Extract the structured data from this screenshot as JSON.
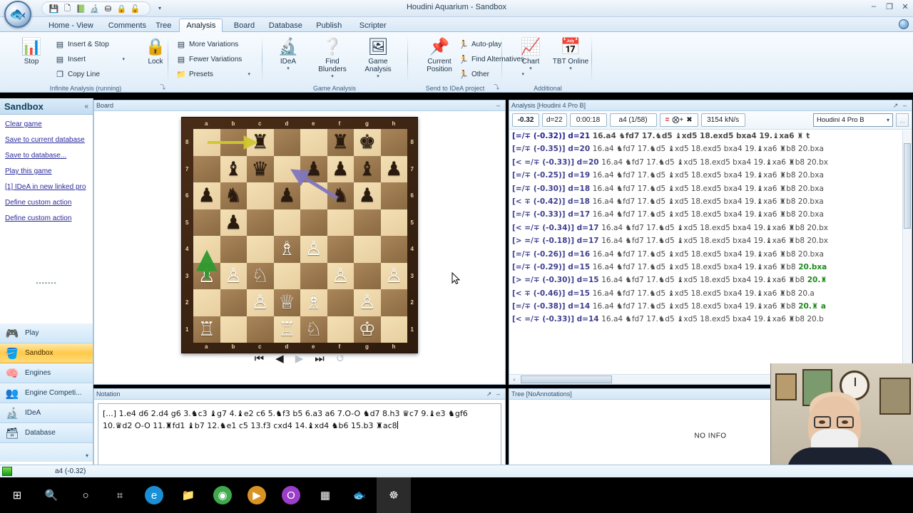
{
  "window": {
    "title": "Houdini Aquarium - Sandbox",
    "minimize": "–",
    "maximize": "❐",
    "close": "✕"
  },
  "quick_access": {
    "icons": [
      "save-icon",
      "new-document-icon",
      "open-book-icon",
      "microscope-icon",
      "engine-icon",
      "lock-gold-icon",
      "lock-green-icon"
    ],
    "glyphs": [
      "💾",
      "🗋",
      "📗",
      "🔬",
      "⛁",
      "🔒",
      "🔓"
    ],
    "more": "▾"
  },
  "ribbon": {
    "tabs": [
      {
        "label": "Home - View",
        "active": false
      },
      {
        "label": "Comments",
        "active": false
      },
      {
        "label": "Tree",
        "active": false
      },
      {
        "label": "Analysis",
        "active": true
      },
      {
        "label": "Board",
        "active": false
      },
      {
        "label": "Database",
        "active": false
      },
      {
        "label": "Publish",
        "active": false
      },
      {
        "label": "Scripter",
        "active": false
      }
    ],
    "groups": [
      {
        "name": "infinite-analysis",
        "label": "Infinite Analysis (running)",
        "big": [
          {
            "label": "Stop",
            "icon": "stop-analysis-icon",
            "glyph": "📊"
          }
        ],
        "small": [
          {
            "label": "Insert & Stop",
            "icon": "insert-stop-icon",
            "glyph": "▤"
          },
          {
            "label": "Insert",
            "icon": "insert-icon",
            "glyph": "▤",
            "arrow": "▾"
          },
          {
            "label": "Copy Line",
            "icon": "copy-line-icon",
            "glyph": "❐"
          }
        ],
        "dialog": "⤵"
      },
      {
        "name": "lock",
        "label": "",
        "big": [
          {
            "label": "Lock",
            "icon": "lock-icon",
            "glyph": "🔒"
          }
        ],
        "small": []
      },
      {
        "name": "variations",
        "label": "",
        "big": [],
        "small": [
          {
            "label": "More Variations",
            "icon": "more-variations-icon",
            "glyph": "▤"
          },
          {
            "label": "Fewer Variations",
            "icon": "fewer-variations-icon",
            "glyph": "▤"
          },
          {
            "label": "Presets",
            "icon": "presets-folder-icon",
            "glyph": "📁",
            "arrow": "▾"
          }
        ]
      },
      {
        "name": "game-analysis",
        "label": "Game Analysis",
        "big": [
          {
            "label": "IDeA",
            "icon": "idea-microscope-icon",
            "glyph": "🔬",
            "arrow": "▾"
          },
          {
            "label": "Find Blunders",
            "icon": "find-blunders-icon",
            "glyph": "❔",
            "arrow": "▾"
          },
          {
            "label": "Game Analysis",
            "icon": "game-analysis-icon",
            "glyph": "🖼",
            "arrow": "▾"
          }
        ],
        "small": []
      },
      {
        "name": "send-to-idea",
        "label": "Send to IDeA project",
        "big": [
          {
            "label": "Current\nPosition",
            "icon": "pushpin-icon",
            "glyph": "📌"
          }
        ],
        "small": [
          {
            "label": "Auto-play",
            "icon": "autoplay-icon",
            "glyph": "🏃"
          },
          {
            "label": "Find Alternatives",
            "icon": "find-alternatives-icon",
            "glyph": "🏃"
          },
          {
            "label": "Other",
            "icon": "other-icon",
            "glyph": "🏃",
            "arrow": "▾"
          }
        ],
        "dialog": "⤵"
      },
      {
        "name": "additional",
        "label": "Additional",
        "big": [
          {
            "label": "Chart",
            "icon": "chart-icon",
            "glyph": "📈",
            "arrow": "▾"
          },
          {
            "label": "TBT Online",
            "icon": "tbt-online-icon",
            "glyph": "📅",
            "arrow": "▾"
          }
        ],
        "small": []
      }
    ]
  },
  "sidebar": {
    "title": "Sandbox",
    "collapse_icon": "collapse-chevrons-icon",
    "links": [
      "Clear game",
      "Save to current database",
      "Save to database...",
      "Play this game",
      "[1] IDeA in new linked pro",
      "Define custom action",
      "Define custom action"
    ],
    "nav": [
      {
        "label": "Play",
        "icon": "play-console-icon",
        "glyph": "🎮",
        "selected": false
      },
      {
        "label": "Sandbox",
        "icon": "sandbox-bucket-icon",
        "glyph": "🪣",
        "selected": true
      },
      {
        "label": "Engines",
        "icon": "engines-brain-icon",
        "glyph": "🧠",
        "selected": false
      },
      {
        "label": "Engine Competi...",
        "icon": "engine-competition-icon",
        "glyph": "👥",
        "selected": false
      },
      {
        "label": "IDeA",
        "icon": "idea-microscope-icon",
        "glyph": "🔬",
        "selected": false
      },
      {
        "label": "Database",
        "icon": "database-icon",
        "glyph": "🗃",
        "selected": false
      }
    ]
  },
  "board_panel": {
    "title": "Board",
    "expand_icon": "expand-arrow-icon",
    "minimize_icon": "minimize-icon",
    "files": [
      "a",
      "b",
      "c",
      "d",
      "e",
      "f",
      "g",
      "h"
    ],
    "ranks": [
      "8",
      "7",
      "6",
      "5",
      "4",
      "3",
      "2",
      "1"
    ],
    "position": [
      [
        "",
        "",
        "r",
        "",
        "",
        "r",
        "k",
        ""
      ],
      [
        "",
        "b",
        "q",
        "",
        "p",
        "p",
        "b",
        "p"
      ],
      [
        "p",
        "n",
        "",
        "p",
        "",
        "n",
        "p",
        ""
      ],
      [
        "",
        "p",
        "",
        "",
        "",
        "",
        "",
        ""
      ],
      [
        "",
        "",
        "",
        "B",
        "P",
        "",
        "",
        ""
      ],
      [
        "P",
        "P",
        "N",
        "",
        "",
        "P",
        "",
        "P"
      ],
      [
        "",
        "",
        "P",
        "Q",
        "B",
        "",
        "P",
        ""
      ],
      [
        "R",
        "",
        "",
        "R",
        "N",
        "",
        "K",
        ""
      ]
    ],
    "arrows": [
      {
        "name": "yellow-arrow-a8-c8",
        "from": "a8",
        "to": "c8",
        "color": "#d8cf3a"
      },
      {
        "name": "purple-arrow-f6-d7",
        "from": "f6",
        "to": "d7",
        "color": "#7b6fb5"
      },
      {
        "name": "green-arrow-a3-a4",
        "from": "a3",
        "to": "a4",
        "color": "#3aa83a"
      }
    ],
    "nav_buttons": [
      {
        "name": "first-move-button",
        "glyph": "⏮",
        "dim": false
      },
      {
        "name": "previous-move-button",
        "glyph": "◀",
        "dim": false
      },
      {
        "name": "next-move-button",
        "glyph": "▶",
        "dim": true
      },
      {
        "name": "last-move-button",
        "glyph": "⏭",
        "dim": false
      },
      {
        "name": "flip-board-button",
        "glyph": "↺",
        "dim": true
      }
    ]
  },
  "analysis_panel": {
    "title": "Analysis [Houdini 4 Pro B]",
    "expand_icon": "expand-arrow-icon",
    "minimize_icon": "minimize-icon",
    "toolbar": {
      "eval": "-0.32",
      "depth": "d=22",
      "time": "0:00:18",
      "move": "a4 (1/58)",
      "sym_eq": "=",
      "sym_plus": "⨂+",
      "sym_stop": "✖",
      "nps": "3154 kN/s",
      "engine": "Houdini 4 Pro B",
      "engine_chevron": "▾",
      "ellipsis_button": "..."
    },
    "scroll_left": "‹",
    "scroll_right": "›",
    "lines": [
      {
        "score": "[=/∓ (-0.32)]",
        "depth": "d=21",
        "moves": "16.a4 ♞fd7 17.♞d5 ♝xd5 18.exd5 bxa4 19.♝xa6 ♜ t",
        "tail": "",
        "first": true
      },
      {
        "score": "[=/∓ (-0.35)]",
        "depth": "d=20",
        "moves": "16.a4 ♞fd7 17.♞d5 ♝xd5 18.exd5 bxa4 19.♝xa6 ♜b8 20.bxa",
        "tail": ""
      },
      {
        "score": "[< =/∓ (-0.33)]",
        "depth": "d=20",
        "moves": "16.a4 ♞fd7 17.♞d5 ♝xd5 18.exd5 bxa4 19.♝xa6 ♜b8 20.bx",
        "tail": ""
      },
      {
        "score": "[=/∓ (-0.25)]",
        "depth": "d=19",
        "moves": "16.a4 ♞fd7 17.♞d5 ♝xd5 18.exd5 bxa4 19.♝xa6 ♜b8 20.bxa",
        "tail": ""
      },
      {
        "score": "[=/∓ (-0.30)]",
        "depth": "d=18",
        "moves": "16.a4 ♞fd7 17.♞d5 ♝xd5 18.exd5 bxa4 19.♝xa6 ♜b8 20.bxa",
        "tail": ""
      },
      {
        "score": "[< ∓ (-0.42)]",
        "depth": "d=18",
        "moves": "16.a4 ♞fd7 17.♞d5 ♝xd5 18.exd5 bxa4 19.♝xa6 ♜b8 20.bxa",
        "tail": ""
      },
      {
        "score": "[=/∓ (-0.33)]",
        "depth": "d=17",
        "moves": "16.a4 ♞fd7 17.♞d5 ♝xd5 18.exd5 bxa4 19.♝xa6 ♜b8 20.bxa",
        "tail": ""
      },
      {
        "score": "[< =/∓ (-0.34)]",
        "depth": "d=17",
        "moves": "16.a4 ♞fd7 17.♞d5 ♝xd5 18.exd5 bxa4 19.♝xa6 ♜b8 20.bx",
        "tail": ""
      },
      {
        "score": "[> =/∓ (-0.18)]",
        "depth": "d=17",
        "moves": "16.a4 ♞fd7 17.♞d5 ♝xd5 18.exd5 bxa4 19.♝xa6 ♜b8 20.bx",
        "tail": ""
      },
      {
        "score": "[=/∓ (-0.26)]",
        "depth": "d=16",
        "moves": "16.a4 ♞fd7 17.♞d5 ♝xd5 18.exd5 bxa4 19.♝xa6 ♜b8 20.bxa",
        "tail": ""
      },
      {
        "score": "[=/∓ (-0.29)]",
        "depth": "d=15",
        "moves": "16.a4 ♞fd7 17.♞d5 ♝xd5 18.exd5 bxa4 19.♝xa6 ♜b8",
        "tail": "20.bxa"
      },
      {
        "score": "[> =/∓ (-0.30)]",
        "depth": "d=15",
        "moves": "16.a4 ♞fd7 17.♞d5 ♝xd5 18.exd5 bxa4 19.♝xa6 ♜b8",
        "tail": "20.♜"
      },
      {
        "score": "[< ∓ (-0.46)]",
        "depth": "d=15",
        "moves": "16.a4 ♞fd7 17.♞d5 ♝xd5 18.exd5 bxa4 19.♝xa6 ♜b8 20.a",
        "tail": ""
      },
      {
        "score": "[=/∓ (-0.38)]",
        "depth": "d=14",
        "moves": "16.a4 ♞fd7 17.♞d5 ♝xd5 18.exd5 bxa4 19.♝xa6 ♜b8",
        "tail": "20.♜ a"
      },
      {
        "score": "[< =/∓ (-0.33)]",
        "depth": "d=14",
        "moves": "16.a4 ♞fd7 17.♞d5 ♝xd5 18.exd5 bxa4 19.♝xa6 ♜b8 20.b",
        "tail": ""
      }
    ]
  },
  "notation_panel": {
    "title": "Notation",
    "expand_icon": "expand-arrow-icon",
    "minimize_icon": "minimize-icon",
    "text": "[...] 1.e4 d6 2.d4 g6 3.♞c3 ♝g7 4.♝e2 c6 5.♞f3 b5 6.a3 a6 7.O-O ♞d7 8.h3 ♛c7 9.♝e3 ♞gf6 10.♛d2 O-O 11.♜fd1 ♝b7 12.♞e1 c5 13.f3 cxd4 14.♝xd4 ♞b6 15.b3 ♜ac8"
  },
  "tree_panel": {
    "title": "Tree [NoAnnotations]",
    "dropdown_icon": "chevron-down-icon",
    "expand_icon": "expand-arrow-icon",
    "minimize_icon": "minimize-icon",
    "message": "NO INFO"
  },
  "status_bar": {
    "indicator": "green-status-icon",
    "text": "a4 (-0.32)"
  },
  "taskbar": {
    "items": [
      {
        "name": "start-button",
        "icon": "windows-logo-icon",
        "glyph": "⊞",
        "color": "#ffffff",
        "bg": "transparent",
        "active": false
      },
      {
        "name": "search-button",
        "icon": "search-icon",
        "glyph": "🔍",
        "color": "#ffffff",
        "bg": "transparent",
        "active": false
      },
      {
        "name": "cortana-button",
        "icon": "cortana-circle-icon",
        "glyph": "○",
        "color": "#ffffff",
        "bg": "transparent",
        "active": false
      },
      {
        "name": "task-view-button",
        "icon": "task-view-icon",
        "glyph": "⌗",
        "color": "#ffffff",
        "bg": "transparent",
        "active": false
      },
      {
        "name": "edge-button",
        "icon": "edge-browser-icon",
        "glyph": "e",
        "color": "#ffffff",
        "bg": "#1b8fd6",
        "active": false
      },
      {
        "name": "file-explorer-button",
        "icon": "folder-icon",
        "glyph": "📁",
        "color": "#f5c24a",
        "bg": "transparent",
        "active": false
      },
      {
        "name": "chrome-button",
        "icon": "chrome-browser-icon",
        "glyph": "◉",
        "color": "#ffffff",
        "bg": "#3fa94c",
        "active": false
      },
      {
        "name": "media-player-button",
        "icon": "media-player-icon",
        "glyph": "▶",
        "color": "#ffffff",
        "bg": "#d99323",
        "active": false
      },
      {
        "name": "opera-button",
        "icon": "opera-browser-icon",
        "glyph": "O",
        "color": "#ffffff",
        "bg": "#9b3ec9",
        "active": false
      },
      {
        "name": "chessbase-button",
        "icon": "checkerboard-icon",
        "glyph": "▦",
        "color": "#ffffff",
        "bg": "transparent",
        "active": false
      },
      {
        "name": "aquarium-button",
        "icon": "aquarium-fish-icon",
        "glyph": "🐟",
        "color": "#5ac8f5",
        "bg": "transparent",
        "active": false
      },
      {
        "name": "houdini-button",
        "icon": "houdini-globe-icon",
        "glyph": "☸",
        "color": "#ffffff",
        "bg": "transparent",
        "active": true
      }
    ]
  },
  "webcam": {
    "name": "webcam-overlay"
  }
}
